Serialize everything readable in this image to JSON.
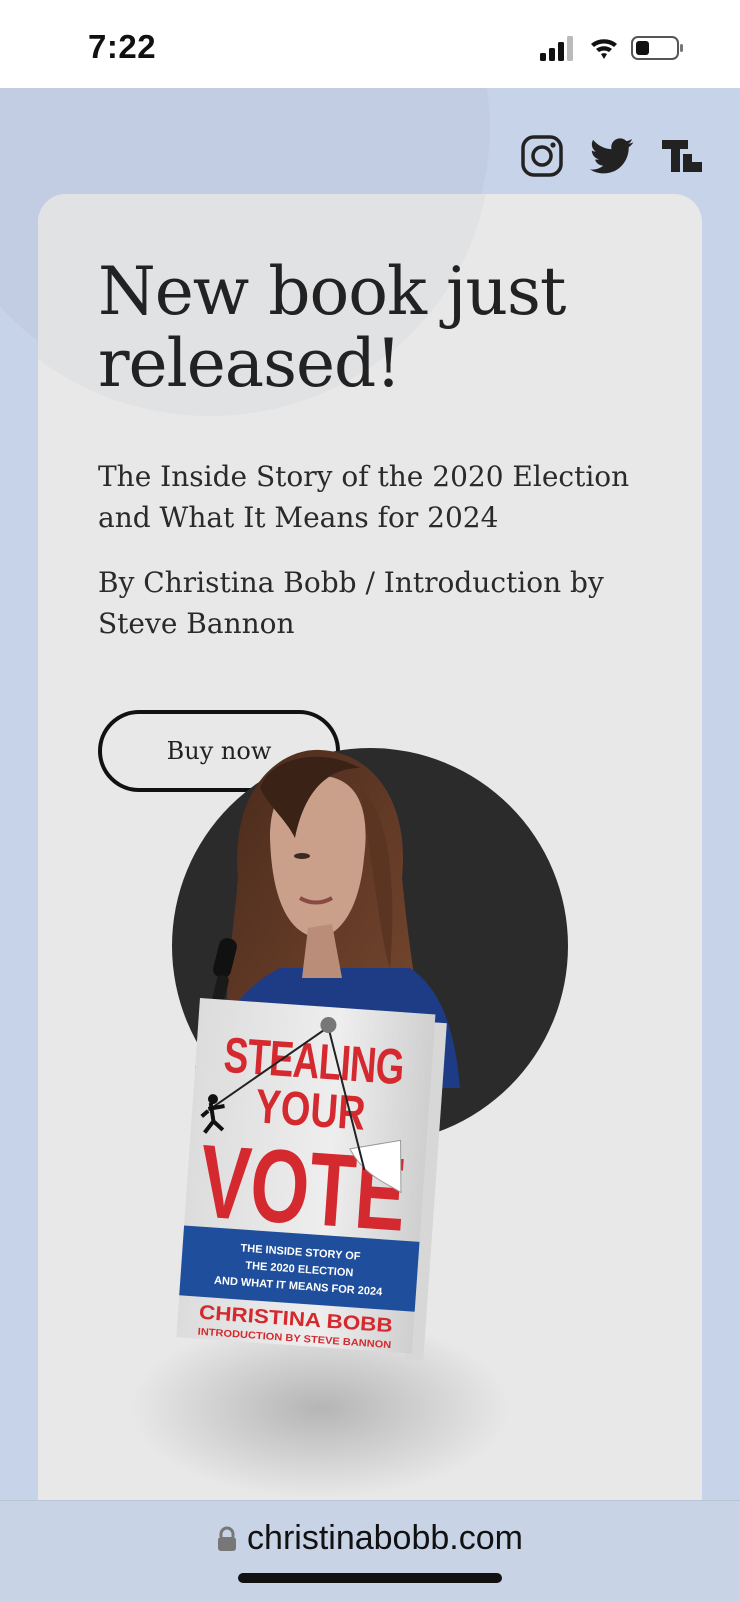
{
  "status_bar": {
    "time": "7:22"
  },
  "social": {
    "icons": [
      "instagram-icon",
      "twitter-icon",
      "truth-social-icon"
    ]
  },
  "hero": {
    "headline": "New book just released!",
    "subtitle": "The Inside Story of the 2020 Election and What It Means for 2024",
    "byline": "By Christina Bobb / Introduction by Steve Bannon",
    "buy_label": "Buy now"
  },
  "book_cover": {
    "title_line1": "STEALING",
    "title_line2": "YOUR",
    "title_line3": "VOTE",
    "tagline_line1": "THE INSIDE STORY OF",
    "tagline_line2": "THE 2020 ELECTION",
    "tagline_line3": "AND WHAT IT MEANS FOR 2024",
    "author": "CHRISTINA BOBB",
    "intro": "INTRODUCTION BY STEVE BANNON"
  },
  "browser": {
    "url": "christinabobb.com"
  },
  "colors": {
    "page_background": "#c7d3e8",
    "card_background": "#e8e8e8",
    "cover_red": "#d42a2f",
    "cover_blue": "#1f4f9c",
    "accent_dark": "#2b2b2b"
  }
}
